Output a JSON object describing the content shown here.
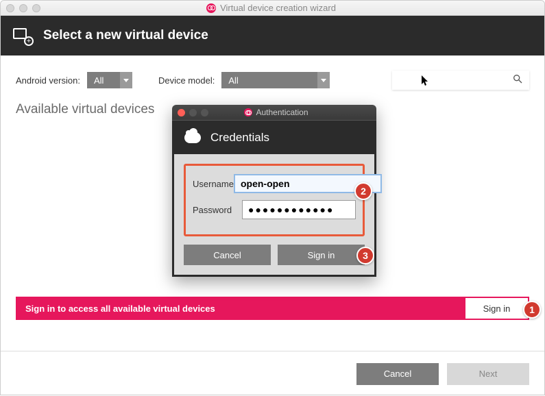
{
  "window": {
    "title": "Virtual device creation wizard"
  },
  "header": {
    "title": "Select a new virtual device"
  },
  "filters": {
    "version_label": "Android version:",
    "version_value": "All",
    "model_label": "Device model:",
    "model_value": "All"
  },
  "section": {
    "title": "Available virtual devices"
  },
  "pink_bar": {
    "text": "Sign in to access all available virtual devices",
    "signin_label": "Sign in"
  },
  "footer": {
    "cancel_label": "Cancel",
    "next_label": "Next"
  },
  "modal": {
    "title": "Authentication",
    "header_title": "Credentials",
    "username_label": "Username",
    "username_value": "open-open",
    "password_label": "Password",
    "password_value": "●●●●●●●●●●●●",
    "cancel_label": "Cancel",
    "signin_label": "Sign in"
  },
  "annotations": {
    "b1": "1",
    "b2": "2",
    "b3": "3"
  }
}
